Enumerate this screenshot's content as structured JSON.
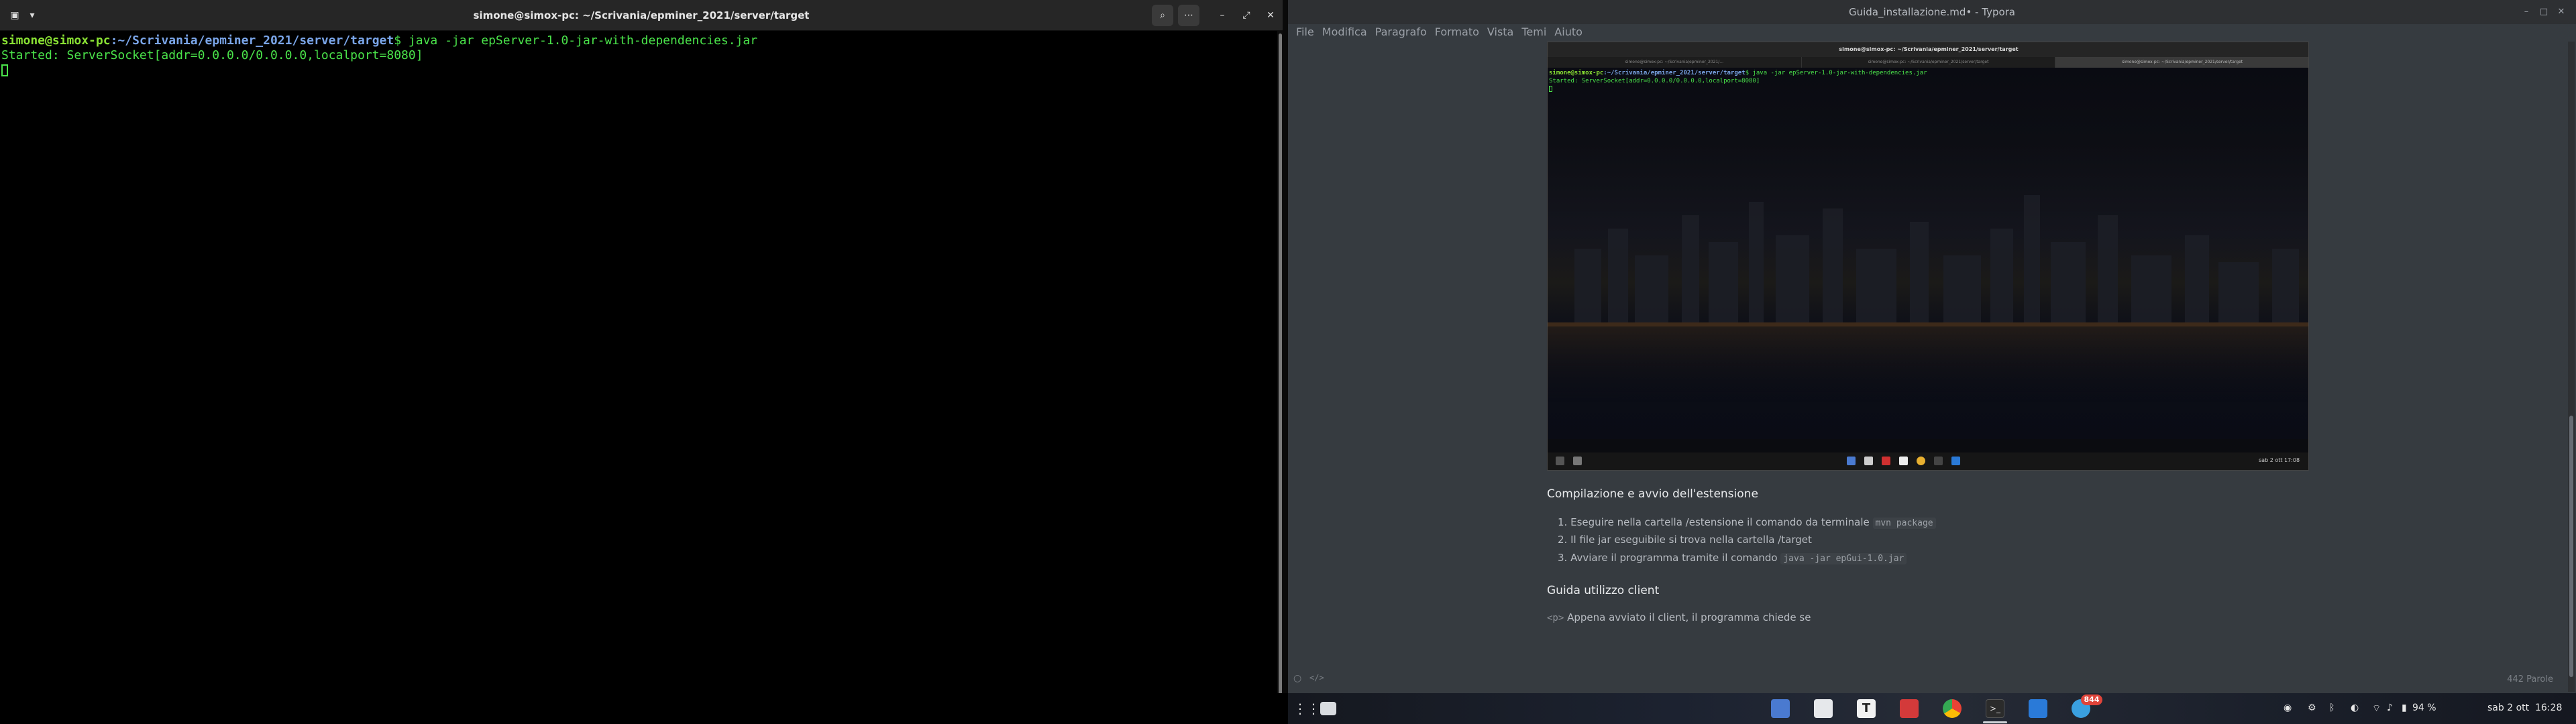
{
  "terminal": {
    "title": "simone@simox-pc: ~/Scrivania/epminer_2021/server/target",
    "prompt_user": "simone@simox-pc",
    "prompt_path": ":~/Scrivania/epminer_2021/server/target",
    "prompt_symbol": "$ ",
    "command": "java -jar epServer-1.0-jar-with-dependencies.jar",
    "output": "Started: ServerSocket[addr=0.0.0.0/0.0.0.0,localport=8080]"
  },
  "typora": {
    "title": "Guida_installazione.md• - Typora",
    "menu": [
      "File",
      "Modifica",
      "Paragrafo",
      "Formato",
      "Vista",
      "Temi",
      "Aiuto"
    ],
    "embedded": {
      "title": "simone@simox-pc: ~/Scrivania/epminer_2021/server/target",
      "tabs": [
        "simone@simox-pc: ~/Scrivania/epminer_2021/...",
        "simone@simox-pc: ~/Scrivania/epminer_2021/server/target",
        "simone@simox-pc: ~/Scrivania/epminer_2021/server/target"
      ],
      "prompt_user": "simone@simox-pc",
      "prompt_path": ":~/Scrivania/epminer_2021/server/target",
      "command": "$ java -jar epServer-1.0-jar-with-dependencies.jar",
      "output": "Started: ServerSocket[addr=0.0.0.0/0.0.0.0,localport=8080]",
      "clock": "sab 2 ott 17:08"
    },
    "section1": {
      "heading": "Compilazione e avvio dell'estensione",
      "items": [
        {
          "text": "Eseguire nella cartella /estensione il comando da terminale ",
          "code": "mvn package"
        },
        {
          "text": "Il file jar eseguibile si trova nella cartella /target",
          "code": ""
        },
        {
          "text": "Avviare il programma tramite il comando ",
          "code": "java -jar epGui-1.0.jar"
        }
      ]
    },
    "section2": {
      "heading": "Guida utilizzo client",
      "tag": "<p>",
      "text": " Appena avviato il client, il programma chiede se"
    },
    "word_count": "442 Parole"
  },
  "taskbar": {
    "badge": "844",
    "battery": "94 %",
    "datetime": "sab 2 ott  16:28"
  },
  "colors": {
    "terminal_bg": "#000000",
    "terminal_text": "#4ae34a",
    "typora_bg": "#363b40",
    "badge": "#e0443a"
  }
}
